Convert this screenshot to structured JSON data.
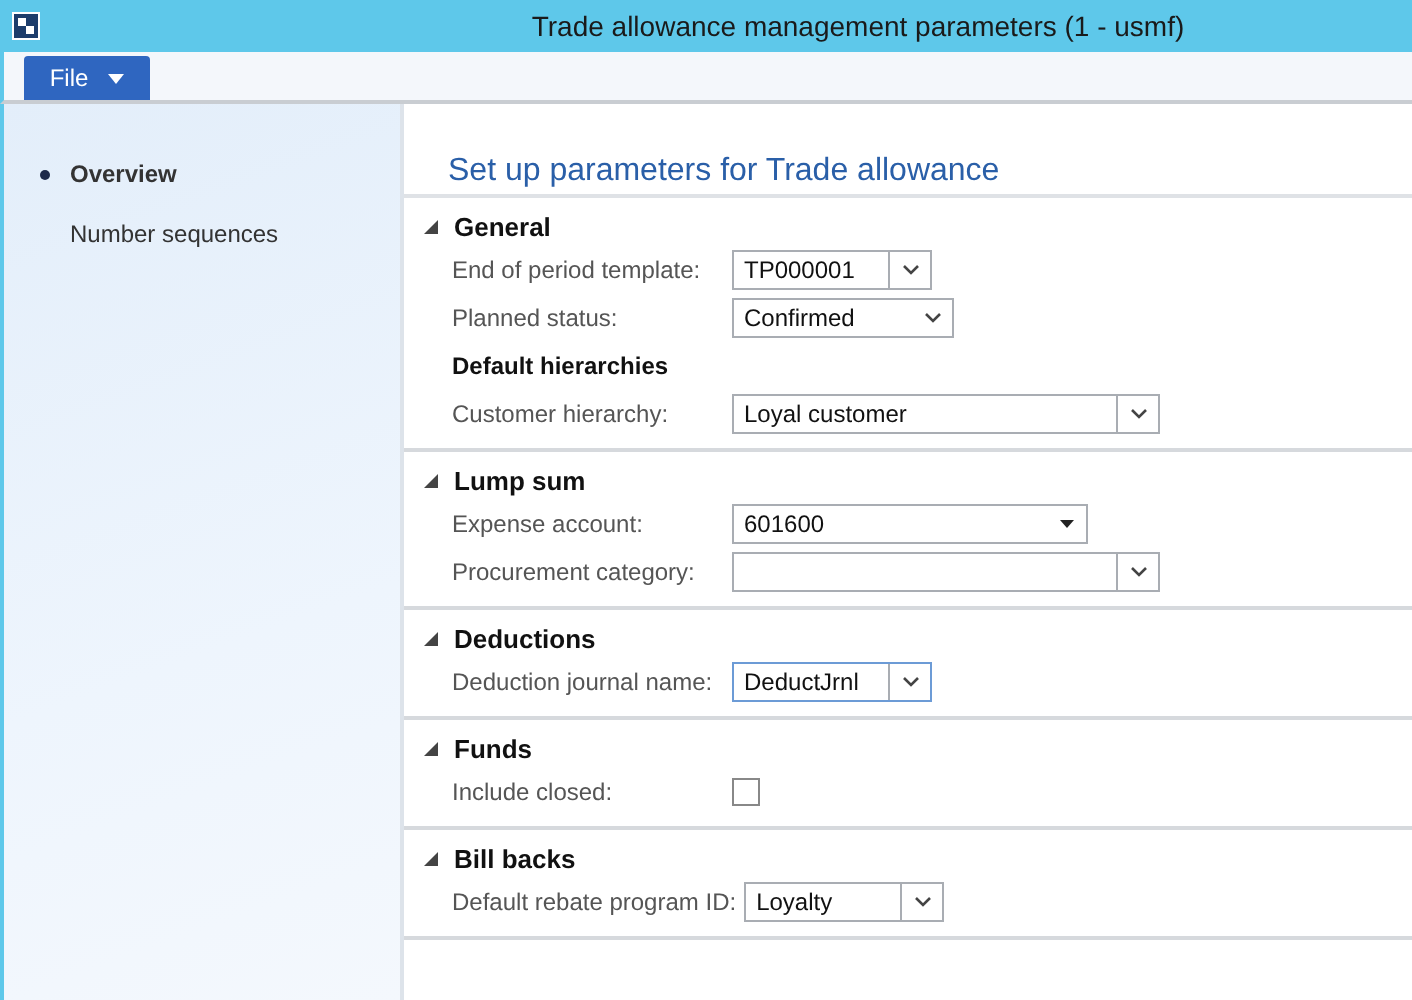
{
  "window": {
    "title": "Trade allowance management parameters (1 - usmf)"
  },
  "menu": {
    "file_label": "File"
  },
  "sidebar": {
    "items": [
      {
        "label": "Overview",
        "selected": true
      },
      {
        "label": "Number sequences",
        "selected": false
      }
    ]
  },
  "page_title": "Set up parameters for Trade allowance",
  "sections": [
    {
      "title": "General",
      "expanded": true,
      "rows": [
        {
          "kind": "combo",
          "label": "End of period template:",
          "value": "TP000001",
          "focused": false
        },
        {
          "kind": "select",
          "label": "Planned status:",
          "value": "Confirmed",
          "focused": false
        },
        {
          "kind": "subheading",
          "label": "Default hierarchies"
        },
        {
          "kind": "combo",
          "label": "Customer hierarchy:",
          "value": "Loyal customer",
          "focused": false
        }
      ]
    },
    {
      "title": "Lump sum",
      "expanded": true,
      "rows": [
        {
          "kind": "lookup",
          "label": "Expense account:",
          "value": "601600",
          "focused": false
        },
        {
          "kind": "combo",
          "label": "Procurement category:",
          "focused": false
        }
      ]
    },
    {
      "title": "Deductions",
      "expanded": true,
      "rows": [
        {
          "kind": "combo",
          "label": "Deduction journal name:",
          "value": "DeductJrnl",
          "focused": true
        }
      ]
    },
    {
      "title": "Funds",
      "expanded": true,
      "rows": [
        {
          "kind": "checkbox",
          "label": "Include closed:",
          "checked": false
        }
      ]
    },
    {
      "title": "Bill backs",
      "expanded": true,
      "rows": [
        {
          "kind": "combo",
          "label": "Default rebate program ID:",
          "value": "Loyalty",
          "focused": false
        }
      ]
    }
  ]
}
